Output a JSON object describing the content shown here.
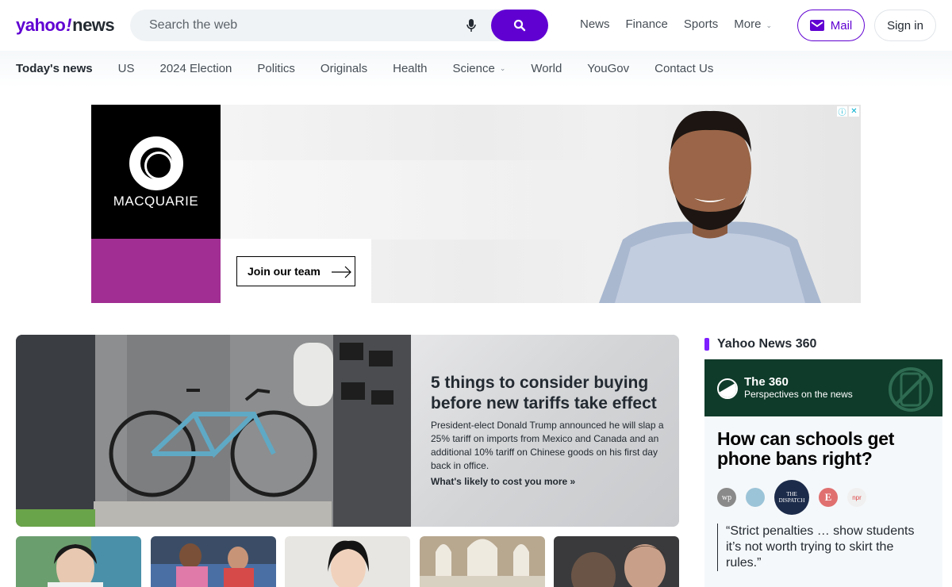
{
  "header": {
    "logo_main": "yahoo",
    "logo_bang": "!",
    "logo_news": "news",
    "search_placeholder": "Search the web",
    "nav": [
      "News",
      "Finance",
      "Sports",
      "More"
    ],
    "mail_label": "Mail",
    "signin_label": "Sign in",
    "accent_color": "#6001d2"
  },
  "subnav": {
    "items": [
      "Today's news",
      "US",
      "2024 Election",
      "Politics",
      "Originals",
      "Health",
      "Science",
      "World",
      "YouGov",
      "Contact Us"
    ],
    "active": "Today's news"
  },
  "ad": {
    "brand": "MACQUARIE",
    "cta": "Join our team",
    "brand_color": "#a12e93"
  },
  "hero": {
    "title": "5 things to consider buying before new tariffs take effect",
    "summary": "President-elect Donald Trump announced he will slap a 25% tariff on imports from Mexico and Canada and an additional 10% tariff on Chinese goods on his first day back in office.",
    "link": "What's likely to cost you more »"
  },
  "rail": {
    "heading": "Yahoo News 360",
    "banner_title": "The 360",
    "banner_subtitle": "Perspectives on the news",
    "headline": "How can schools get phone bans right?",
    "sources": [
      "wp",
      "",
      "THE DISPATCH",
      "E",
      "npr"
    ],
    "quote": "“Strict penalties … show students it’s not worth trying to skirt the rules.”"
  },
  "thumbnails": [
    "woman-smiling",
    "two-people-couch",
    "woman-portrait",
    "cathedral-interior",
    "two-men-portrait"
  ]
}
